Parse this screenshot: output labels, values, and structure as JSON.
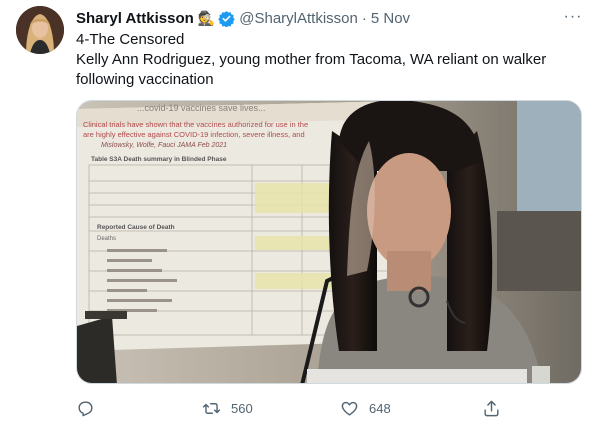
{
  "tweet": {
    "author_name": "Sharyl Attkisson",
    "author_emoji": "🕵",
    "handle": "@SharylAttkisson",
    "separator": "·",
    "date": "5 Nov",
    "more_label": "···",
    "text_lines": [
      "4-The Censored",
      "Kelly Ann Rodriguez, young mother from Tacoma, WA reliant on walker",
      "following vaccination"
    ]
  },
  "media": {
    "doc_lines": [
      "Clinical trials have shown that the vaccines authorized for use in the",
      "are highly effective against COVID-19 infection, severe illness, and",
      "Mislowsky, Wolfe, Fauci  JAMA  Feb 2021",
      "Table S3A  Death summary in Blinded Phase",
      "Reported Cause of Death",
      "Deaths"
    ],
    "banner_text": "...covid-19 vaccines save lives..."
  },
  "actions": {
    "reply_count": "",
    "retweet_count": "560",
    "like_count": "648"
  },
  "colors": {
    "verified": "#1d9bf0",
    "muted": "#536471",
    "text": "#0f1419"
  }
}
